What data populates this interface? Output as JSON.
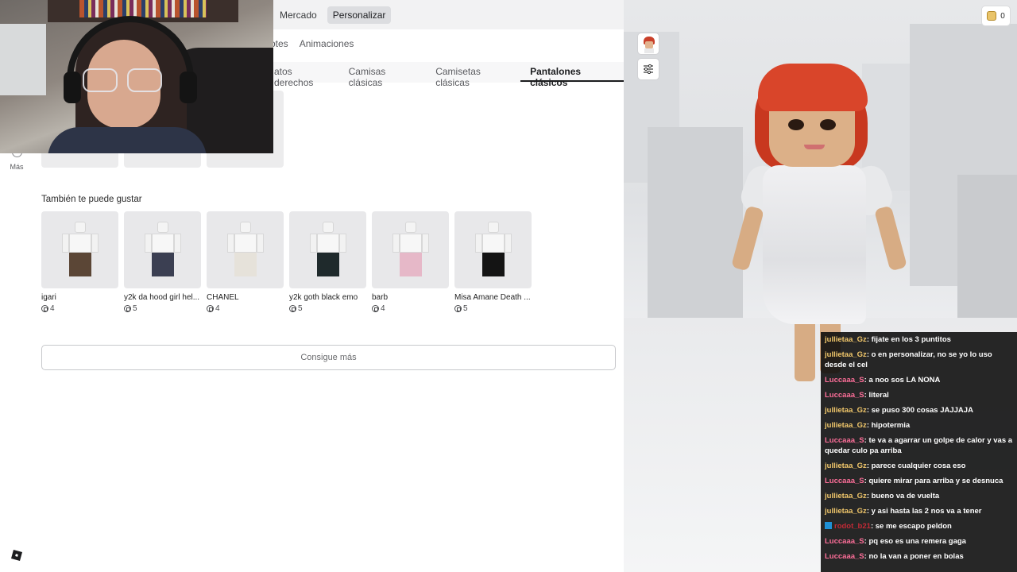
{
  "top_nav": {
    "tabs": [
      {
        "label": "Mercado",
        "active": false
      },
      {
        "label": "Personalizar",
        "active": true
      }
    ]
  },
  "sub_nav": {
    "items": [
      "motes",
      "Animaciones"
    ]
  },
  "category_tabs": [
    {
      "label": "atos derechos",
      "active": false
    },
    {
      "label": "Camisas clásicas",
      "active": false
    },
    {
      "label": "Camisetas clásicas",
      "active": false
    },
    {
      "label": "Pantalones clásicos",
      "active": true
    }
  ],
  "side_rail": {
    "more_label": "Más"
  },
  "recommendations": {
    "title": "También te puede gustar",
    "items": [
      {
        "name": "igari",
        "price": "4",
        "legs_color": "#5b4636"
      },
      {
        "name": "y2k da hood girl hel...",
        "price": "5",
        "legs_color": "#3b3f52"
      },
      {
        "name": "CHANEL",
        "price": "4",
        "legs_color": "#e6e2da"
      },
      {
        "name": "y2k goth black emo",
        "price": "5",
        "legs_color": "#1f2a2c"
      },
      {
        "name": "barb",
        "price": "4",
        "legs_color": "#e6b8c8"
      },
      {
        "name": "Misa Amane Death ...",
        "price": "5",
        "legs_color": "#141414"
      }
    ],
    "get_more_label": "Consigue más"
  },
  "preview": {
    "robux_balance": "0"
  },
  "chat": {
    "messages": [
      {
        "user": "jullietaa_Gz",
        "color": "#f2c86b",
        "text": ": fijate en los 3 puntitos"
      },
      {
        "user": "jullietaa_Gz",
        "color": "#f2c86b",
        "text": ": o en personalizar, no se yo lo uso desde el cel"
      },
      {
        "user": "Luccaaa_S",
        "color": "#ff6f9a",
        "text": ": a noo sos LA NONA"
      },
      {
        "user": "Luccaaa_S",
        "color": "#ff6f9a",
        "text": ": literal"
      },
      {
        "user": "jullietaa_Gz",
        "color": "#f2c86b",
        "text": ": se puso 300 cosas JAJJAJA"
      },
      {
        "user": "jullietaa_Gz",
        "color": "#f2c86b",
        "text": ": hipotermia"
      },
      {
        "user": "Luccaaa_S",
        "color": "#ff6f9a",
        "text": ": te va a agarrar un golpe de calor y vas a quedar culo pa arriba"
      },
      {
        "user": "jullietaa_Gz",
        "color": "#f2c86b",
        "text": ": parece cualquier cosa eso"
      },
      {
        "user": "Luccaaa_S",
        "color": "#ff6f9a",
        "text": ": quiere mirar para arriba y se desnuca"
      },
      {
        "user": "jullietaa_Gz",
        "color": "#f2c86b",
        "text": ": bueno va de vuelta"
      },
      {
        "user": "jullietaa_Gz",
        "color": "#f2c86b",
        "text": ": y asi hasta las 2 nos va a tener"
      },
      {
        "user": "rodot_b21",
        "color": "#c22a36",
        "badge": true,
        "text": ": se me escapo peldon"
      },
      {
        "user": "Luccaaa_S",
        "color": "#ff6f9a",
        "text": ": pq eso es una remera gaga"
      },
      {
        "user": "Luccaaa_S",
        "color": "#ff6f9a",
        "text": ": no la van a poner en bolas"
      }
    ]
  }
}
